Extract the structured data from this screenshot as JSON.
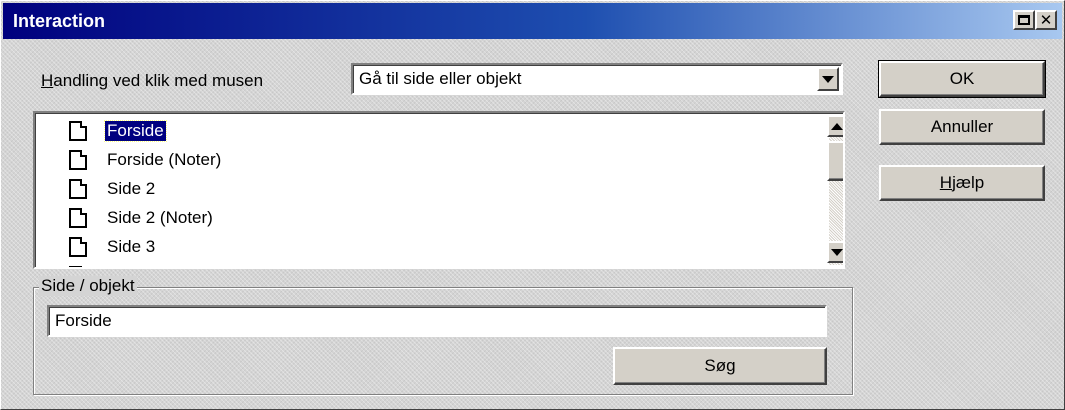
{
  "window": {
    "title": "Interaction"
  },
  "action": {
    "label_accel": "H",
    "label_rest": "andling ved klik med musen",
    "selected": "Gå til side eller objekt"
  },
  "pages": {
    "items": [
      "Forside",
      "Forside (Noter)",
      "Side 2",
      "Side 2 (Noter)",
      "Side 3"
    ],
    "selected_index": 0
  },
  "group": {
    "legend": "Side / objekt",
    "value": "Forside",
    "search_label": "Søg"
  },
  "buttons": {
    "ok": "OK",
    "cancel": "Annuller",
    "help_accel": "H",
    "help_rest": "jælp"
  },
  "colors": {
    "selection": "#000080",
    "title_start": "#00007e",
    "title_end": "#a8c8f0"
  }
}
